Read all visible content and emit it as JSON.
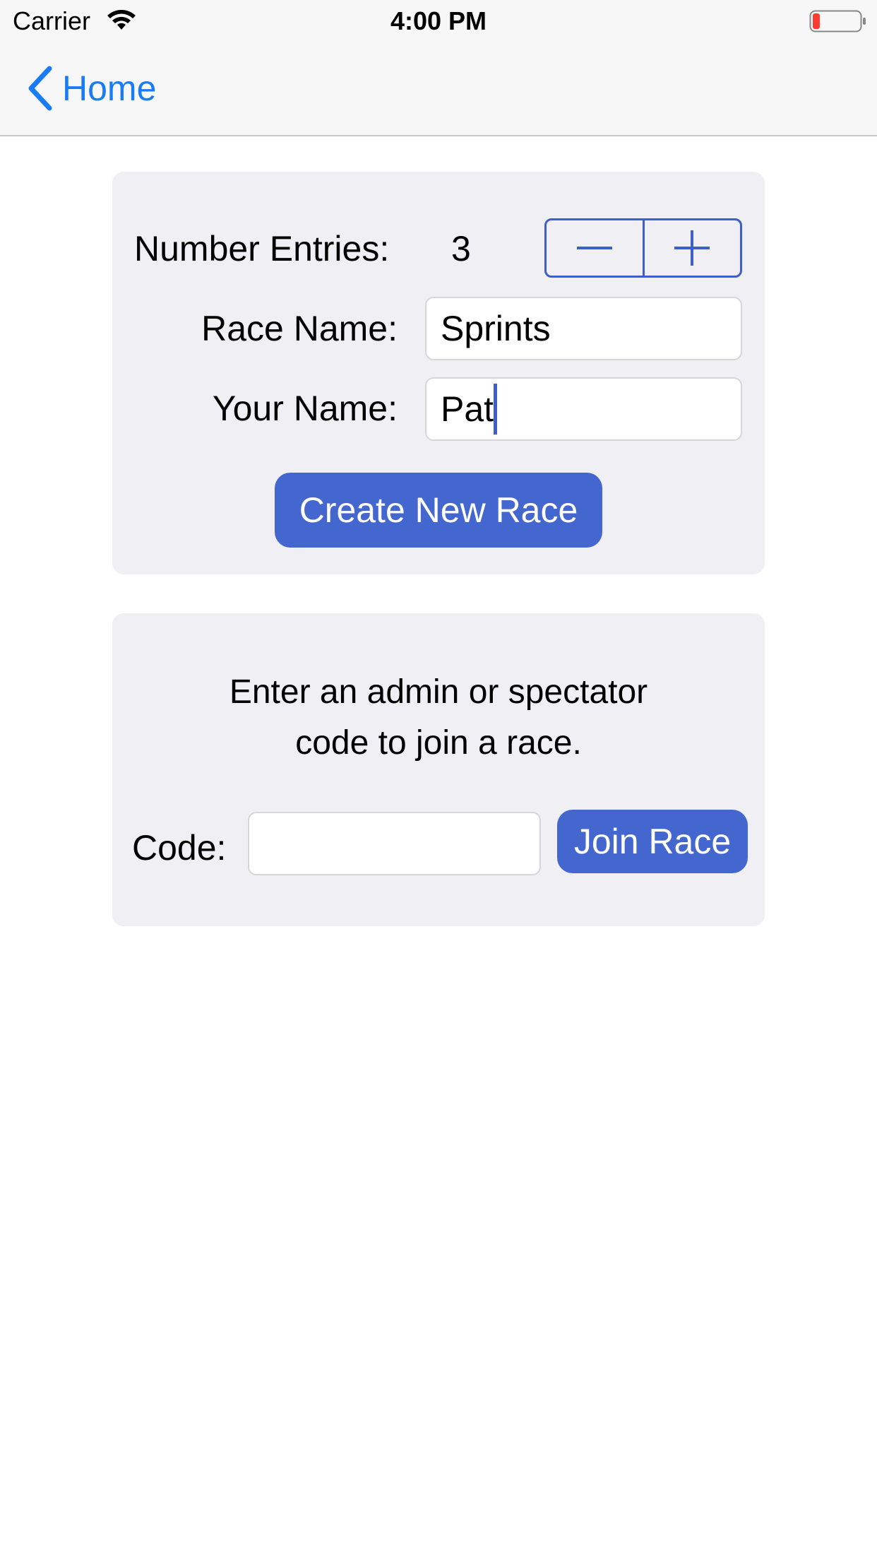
{
  "status_bar": {
    "carrier": "Carrier",
    "time": "4:00 PM",
    "icons": [
      "wifi-icon",
      "battery-low-icon"
    ]
  },
  "nav": {
    "back_label": "Home",
    "back_icon": "chevron-left-icon"
  },
  "create_race": {
    "entries_label": "Number Entries:",
    "entries_value": "3",
    "stepper_decrement": "−",
    "stepper_increment": "+",
    "race_name_label": "Race Name:",
    "race_name_value": "Sprints",
    "your_name_label": "Your Name:",
    "your_name_value": "Pat",
    "create_button": "Create New Race"
  },
  "join_race": {
    "instructions_line1": "Enter an admin or spectator",
    "instructions_line2": "code to join a race.",
    "code_label": "Code:",
    "code_value": "",
    "join_button": "Join Race"
  },
  "colors": {
    "accent": "#4366cf",
    "nav_tint": "#1a7cf5",
    "panel_bg": "#efeff4",
    "bar_bg": "#f7f7f7",
    "battery_level": "#ff3b30"
  }
}
